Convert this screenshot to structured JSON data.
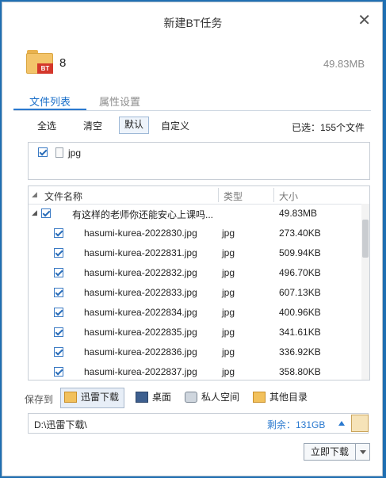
{
  "dialog": {
    "title": "新建BT任务",
    "close_glyph": "✕"
  },
  "task": {
    "name": "8",
    "size": "49.83MB",
    "icon_badge": "BT"
  },
  "tabs": [
    {
      "label": "文件列表",
      "active": true
    },
    {
      "label": "属性设置",
      "active": false
    }
  ],
  "toolbar": {
    "select_all": "全选",
    "clear": "清空",
    "default": "默认",
    "custom": "自定义",
    "selected_count": "已选：155个文件"
  },
  "filter": {
    "type_label": "jpg",
    "checked": true
  },
  "tree": {
    "columns": {
      "name": "文件名称",
      "type": "类型",
      "size": "大小"
    },
    "root": {
      "name": "有这样的老师你还能安心上课吗...",
      "size": "49.83MB",
      "checked": true
    },
    "rows": [
      {
        "name": "hasumi-kurea-2022830.jpg",
        "type": "jpg",
        "size": "273.40KB"
      },
      {
        "name": "hasumi-kurea-2022831.jpg",
        "type": "jpg",
        "size": "509.94KB"
      },
      {
        "name": "hasumi-kurea-2022832.jpg",
        "type": "jpg",
        "size": "496.70KB"
      },
      {
        "name": "hasumi-kurea-2022833.jpg",
        "type": "jpg",
        "size": "607.13KB"
      },
      {
        "name": "hasumi-kurea-2022834.jpg",
        "type": "jpg",
        "size": "400.96KB"
      },
      {
        "name": "hasumi-kurea-2022835.jpg",
        "type": "jpg",
        "size": "341.61KB"
      },
      {
        "name": "hasumi-kurea-2022836.jpg",
        "type": "jpg",
        "size": "336.92KB"
      },
      {
        "name": "hasumi-kurea-2022837.jpg",
        "type": "jpg",
        "size": "358.80KB"
      }
    ]
  },
  "save": {
    "label": "保存到",
    "targets": [
      {
        "label": "迅雷下载",
        "icon": "thunder-folder-icon",
        "selected": true
      },
      {
        "label": "桌面",
        "icon": "desktop-icon",
        "selected": false
      },
      {
        "label": "私人空间",
        "icon": "private-space-icon",
        "selected": false
      },
      {
        "label": "其他目录",
        "icon": "folder-icon",
        "selected": false
      }
    ],
    "path": "D:\\迅雷下载\\",
    "free_space": "剩余：131GB"
  },
  "action": {
    "download_now": "立即下载"
  },
  "colors": {
    "accent": "#2a79cf",
    "window_bg": "#1f6fb2"
  }
}
